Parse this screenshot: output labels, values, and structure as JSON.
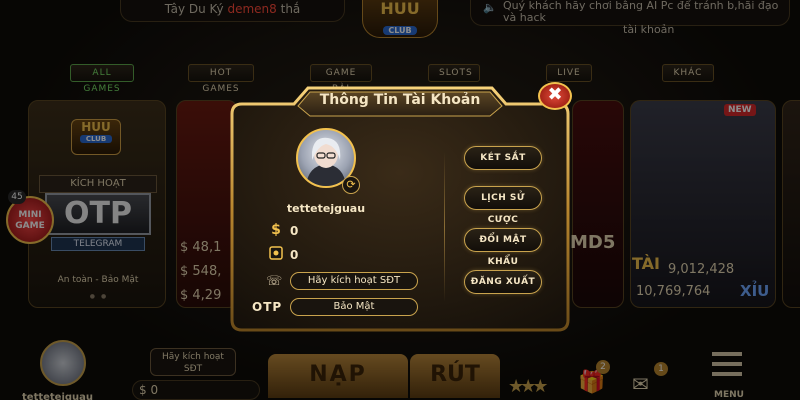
{
  "header": {
    "ticker_left_prefix": "Tây Du Ký",
    "ticker_left_user": "demen8",
    "ticker_left_suffix": "thắ",
    "ticker_right_line1": "Quý khách hãy chơi bằng AI Pc để tránh b,hãi đạo và hack",
    "ticker_right_line2": "tài khoản",
    "logo_text": "HUU",
    "logo_sub": "CLUB"
  },
  "tabs": [
    {
      "label": "ALL GAMES"
    },
    {
      "label": "HOT GAMES"
    },
    {
      "label": "GAME BÀI"
    },
    {
      "label": "SLOTS"
    },
    {
      "label": "LIVE"
    },
    {
      "label": "KHÁC"
    }
  ],
  "background": {
    "otp_card": {
      "logo": "HUU",
      "logo_sub": "CLUB",
      "kich_hoat": "KÍCH HOẠT",
      "otp": "OTP",
      "telegram": "TELEGRAM",
      "an_toan": "An toàn - Bảo Mật"
    },
    "mini_game": {
      "count": "45",
      "label_line1": "MINI",
      "label_line2": "GAME"
    },
    "jackpots": [
      "$ 48,1",
      "$ 548,",
      "$ 4,29"
    ],
    "md5": "MD5",
    "tai": "TÀI",
    "xiu": "XỈU",
    "tai_values": [
      "9,012,428",
      "10,769,764"
    ],
    "new_badge": "NEW"
  },
  "modal": {
    "title": "Thông Tin Tài Khoản",
    "close_label": "✖",
    "username": "tettetejguau",
    "balance_icon": "$",
    "balance": "0",
    "secondary_balance": "0",
    "phone_button": "Hãy kích hoạt SĐT",
    "otp_label": "OTP",
    "otp_button": "Bảo Mật",
    "actions": [
      {
        "label": "KÉT SẮT"
      },
      {
        "label": "LỊCH SỬ CƯỢC"
      },
      {
        "label": "ĐỔI MẬT KHẨU"
      },
      {
        "label": "ĐĂNG XUẤT"
      }
    ]
  },
  "bottom": {
    "username": "tettetejguau",
    "kich_hoat_line1": "Hãy kích hoạt",
    "kich_hoat_line2": "SĐT",
    "money": "$ 0",
    "nap": "NẠP",
    "rut": "RÚT",
    "gift_badge": "2",
    "mail_badge": "1",
    "menu": "MENU"
  },
  "colors": {
    "gold": "#f2c14e",
    "modal_bg": "#1e160d",
    "accent_green": "#7be36a",
    "close_red": "#d8282a"
  }
}
